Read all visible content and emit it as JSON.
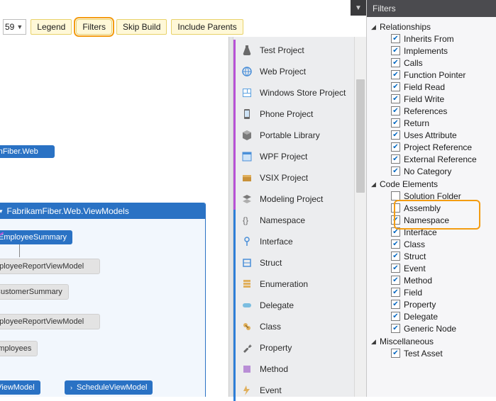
{
  "toolbar": {
    "dropdown_fragment": "59",
    "legend": "Legend",
    "filters": "Filters",
    "skip_build": "Skip Build",
    "include_parents": "Include Parents"
  },
  "diagram": {
    "node_web": "ıkamFiber.Web",
    "group_title": "FabrikamFiber.Web.ViewModels",
    "node_employee_summary": "EmployeeSummary",
    "node_report_vm_1": "mployeeReportViewModel",
    "node_customer_summary": "tCustomerSummary",
    "node_report_vm_2": "mployeeReportViewModel",
    "node_employees": "Employees",
    "node_view_model": "nViewModel",
    "node_schedule_vm": "ScheduleViewModel"
  },
  "toolbox": {
    "items": [
      {
        "label": "Test Project",
        "icon": "flask",
        "accent": "purple"
      },
      {
        "label": "Web Project",
        "icon": "globe",
        "accent": "purple"
      },
      {
        "label": "Windows Store Project",
        "icon": "store",
        "accent": "purple"
      },
      {
        "label": "Phone Project",
        "icon": "phone",
        "accent": "purple"
      },
      {
        "label": "Portable Library",
        "icon": "cube",
        "accent": "purple"
      },
      {
        "label": "WPF Project",
        "icon": "window",
        "accent": "purple"
      },
      {
        "label": "VSIX Project",
        "icon": "box",
        "accent": "purple"
      },
      {
        "label": "Modeling Project",
        "icon": "layers",
        "accent": "purple"
      },
      {
        "label": "Namespace",
        "icon": "braces",
        "accent": "blue"
      },
      {
        "label": "Interface",
        "icon": "lolli",
        "accent": "blue"
      },
      {
        "label": "Struct",
        "icon": "struct",
        "accent": "blue"
      },
      {
        "label": "Enumeration",
        "icon": "enum",
        "accent": "blue"
      },
      {
        "label": "Delegate",
        "icon": "deleg",
        "accent": "blue"
      },
      {
        "label": "Class",
        "icon": "class",
        "accent": "blue"
      },
      {
        "label": "Property",
        "icon": "wrench",
        "accent": "blue"
      },
      {
        "label": "Method",
        "icon": "method",
        "accent": "blue"
      },
      {
        "label": "Event",
        "icon": "bolt",
        "accent": "blue"
      }
    ]
  },
  "filters_panel": {
    "title": "Filters",
    "sections": [
      {
        "title": "Relationships",
        "items": [
          {
            "label": "Inherits From",
            "checked": true
          },
          {
            "label": "Implements",
            "checked": true
          },
          {
            "label": "Calls",
            "checked": true
          },
          {
            "label": "Function Pointer",
            "checked": true
          },
          {
            "label": "Field Read",
            "checked": true
          },
          {
            "label": "Field Write",
            "checked": true
          },
          {
            "label": "References",
            "checked": true
          },
          {
            "label": "Return",
            "checked": true
          },
          {
            "label": "Uses Attribute",
            "checked": true
          },
          {
            "label": "Project Reference",
            "checked": true
          },
          {
            "label": "External Reference",
            "checked": true
          },
          {
            "label": "No Category",
            "checked": true
          }
        ]
      },
      {
        "title": "Code Elements",
        "items": [
          {
            "label": "Solution Folder",
            "checked": false
          },
          {
            "label": "Assembly",
            "checked": false
          },
          {
            "label": "Namespace",
            "checked": true
          },
          {
            "label": "Interface",
            "checked": true
          },
          {
            "label": "Class",
            "checked": true
          },
          {
            "label": "Struct",
            "checked": true
          },
          {
            "label": "Event",
            "checked": true
          },
          {
            "label": "Method",
            "checked": true
          },
          {
            "label": "Field",
            "checked": true
          },
          {
            "label": "Property",
            "checked": true
          },
          {
            "label": "Delegate",
            "checked": true
          },
          {
            "label": "Generic Node",
            "checked": true
          }
        ]
      },
      {
        "title": "Miscellaneous",
        "items": [
          {
            "label": "Test Asset",
            "checked": true
          }
        ]
      }
    ]
  }
}
